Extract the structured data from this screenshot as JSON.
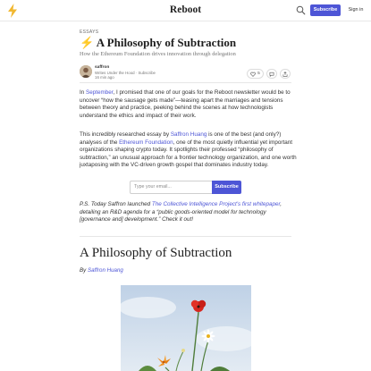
{
  "nav": {
    "brand": "Reboot",
    "subscribe_label": "Subscribe",
    "signin_label": "Sign in",
    "icons": [
      "lightning-logo-icon",
      "search-icon"
    ]
  },
  "post": {
    "section": "ESSAYS",
    "title": "A Philosophy of Subtraction",
    "subtitle": "How the Ethereum Foundation drives innovation through delegation",
    "author": {
      "name": "saffron",
      "meta": "Writes Under the Hood · Subscribe",
      "time": "16 min ago"
    },
    "actions": {
      "likes": "5"
    }
  },
  "body": {
    "p1": {
      "l1_a": "In ",
      "l1_link": "September",
      "l1_b": ", I promised that one of our goals for the Reboot newsletter would be to",
      "l2": "uncover “how the sausage gets made”—teasing apart the marriages and tensions",
      "l3": "between theory and practice, peeking behind the scenes at how technologists",
      "l4": "understand the ethics and impact of their work."
    },
    "p2": {
      "l1_a": "This incredibly researched essay by ",
      "l1_link": "Saffron Huang",
      "l1_b": " is one of the best (and only?)",
      "l2_a": "analyses of the ",
      "l2_link": "Ethereum Foundation",
      "l2_b": ", one of the most quietly influential yet important",
      "l3": "organizations shaping crypto today. It spotlights their professed “philosophy of",
      "l4": "subtraction,” an unusual approach for a frontier technology organization, and one worth",
      "l5": "juxtaposing with the VC-driven growth gospel that dominates industry today."
    },
    "signup": {
      "placeholder": "Type your email...",
      "button": "Subscribe"
    },
    "ps": {
      "l1_a": "P.S. Today Saffron launched ",
      "l1_link": "The Collective Intelligence Project’s first whitepaper",
      "l1_b": ",",
      "l2": "detailing an R&D agenda for a “public goods-oriented model for technology",
      "l3": "[governance and] development.” Check it out!"
    },
    "essay_heading": "A Philosophy of Subtraction",
    "byline_by": "By ",
    "byline_author": "Saffron Huang"
  },
  "colors": {
    "accent": "#4d55d6",
    "bolt": "#f1b72f"
  }
}
